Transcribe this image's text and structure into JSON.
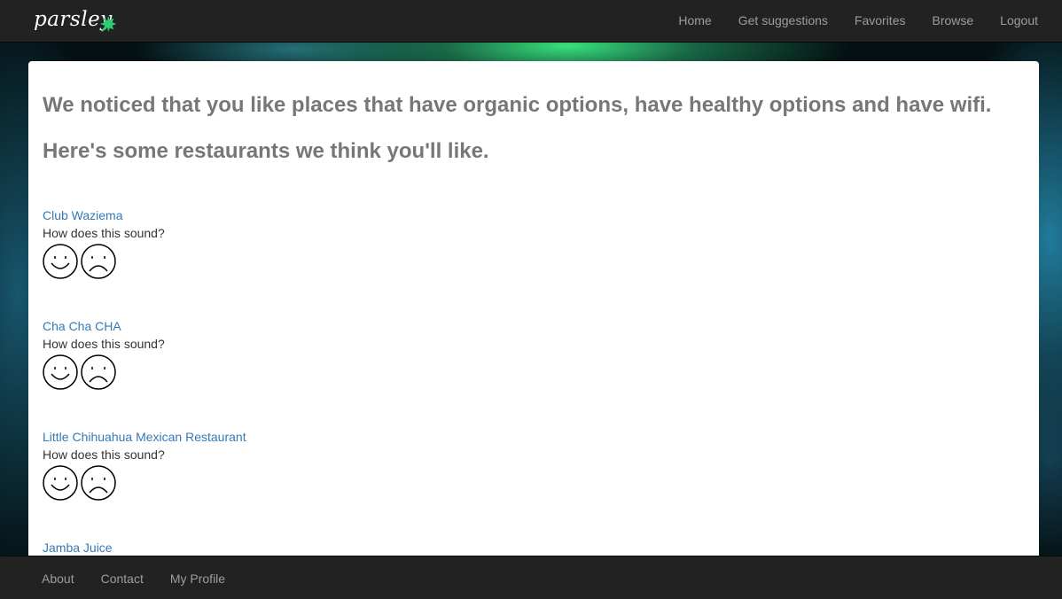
{
  "brand": {
    "name": "parsley",
    "icon": "leaf-icon",
    "icon_color": "#2ecc71"
  },
  "nav": {
    "items": [
      {
        "label": "Home"
      },
      {
        "label": "Get suggestions"
      },
      {
        "label": "Favorites"
      },
      {
        "label": "Browse"
      },
      {
        "label": "Logout"
      }
    ]
  },
  "main": {
    "headline": "We noticed that you like places that have organic options, have healthy options and have wifi.",
    "subheadline": "Here's some restaurants we think you'll like.",
    "prompt": "How does this sound?",
    "restaurants": [
      {
        "name": "Club Waziema",
        "prompt": "How does this sound?"
      },
      {
        "name": "Cha Cha CHA",
        "prompt": "How does this sound?"
      },
      {
        "name": "Little Chihuahua Mexican Restaurant",
        "prompt": "How does this sound?"
      },
      {
        "name": "Jamba Juice"
      }
    ],
    "link_color": "#337ab7",
    "headline_color": "#777777"
  },
  "footer": {
    "items": [
      {
        "label": "About"
      },
      {
        "label": "Contact"
      },
      {
        "label": "My Profile"
      }
    ]
  }
}
